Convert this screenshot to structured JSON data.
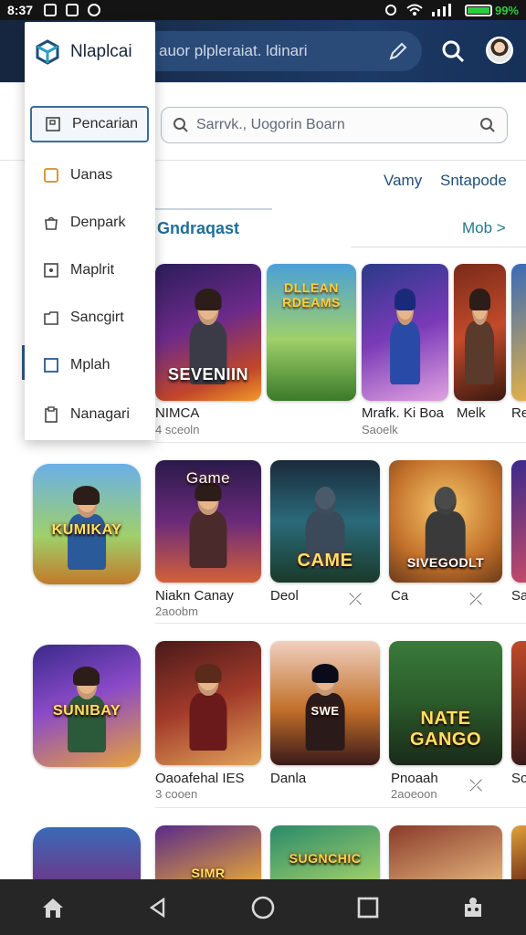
{
  "status_bar": {
    "time": "8:37",
    "battery_pct": "99%",
    "battery_level": 0.99
  },
  "top_bar": {
    "search_text": "auor plpleraiat. ldinari"
  },
  "search": {
    "placeholder": "Sarrvk., Uogorin Boarn"
  },
  "tabs": {
    "left": "Vamy",
    "right": "Sntapode"
  },
  "section": {
    "title": "Gndraqast",
    "more": "Mob >"
  },
  "drawer": {
    "title": "Nlaplcai",
    "items": [
      {
        "label": "Pencarian",
        "icon": "save-icon",
        "active": true
      },
      {
        "label": "Uanas",
        "icon": "square-orange-icon"
      },
      {
        "label": "Denpark",
        "icon": "bag-icon"
      },
      {
        "label": "Maplrit",
        "icon": "image-icon"
      },
      {
        "label": "Sancgirt",
        "icon": "folder-icon"
      },
      {
        "label": "Mplah",
        "icon": "square-blue-icon"
      },
      {
        "label": "Nanagari",
        "icon": "clipboard-icon"
      }
    ]
  },
  "rows": [
    {
      "games": [
        {
          "name": "NIMCA",
          "sub": "4 sceoln",
          "art_text": "SEVENIIN"
        },
        {
          "name": "",
          "sub": "",
          "art_text": "DLLEAN RDEAMS"
        },
        {
          "name": "Mrafk. Ki Boa",
          "sub": "Saoelk",
          "art_text": ""
        },
        {
          "name": "Melk",
          "sub": "",
          "art_text": ""
        },
        {
          "name": "Re",
          "sub": "",
          "art_text": ""
        }
      ]
    },
    {
      "side_art": "KUMIKAY",
      "games": [
        {
          "name": "Niakn Canay",
          "sub": "2aoobm",
          "art_text": "Game"
        },
        {
          "name": "Deol",
          "sub": "",
          "art_text": "CAME"
        },
        {
          "name": "Ca",
          "sub": "",
          "art_text": "SIVEGODLT"
        },
        {
          "name": "Sa",
          "sub": "",
          "art_text": ""
        }
      ]
    },
    {
      "side_art": "SUNIBAY",
      "games": [
        {
          "name": "Oaoafehal IES",
          "sub": "3 cooen",
          "art_text": ""
        },
        {
          "name": "Danla",
          "sub": "",
          "art_text": "SWE"
        },
        {
          "name": "Pnoaah",
          "sub": "2aoeoon",
          "art_text": "NATE GANGO"
        },
        {
          "name": "So",
          "sub": "",
          "art_text": ""
        }
      ]
    },
    {
      "games": [
        {
          "name": "",
          "sub": "",
          "art_text": ""
        },
        {
          "name": "",
          "sub": "",
          "art_text": "SIMR"
        },
        {
          "name": "",
          "sub": "",
          "art_text": "SUGNCHIC"
        },
        {
          "name": "",
          "sub": "",
          "art_text": ""
        }
      ]
    }
  ],
  "colors": {
    "appbar": "#1c3a66",
    "accent": "#1f6f9a",
    "active_border": "#3b6e98"
  },
  "nav": [
    "home-icon",
    "back-icon",
    "home-circle-icon",
    "recents-icon",
    "assistant-icon"
  ]
}
